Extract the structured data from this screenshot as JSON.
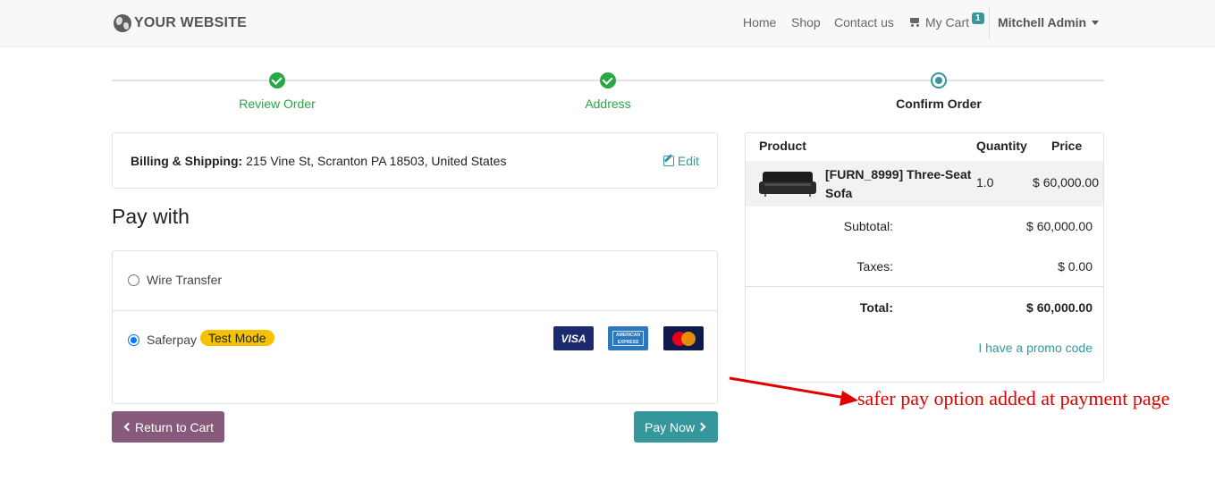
{
  "header": {
    "logo_text": "YOUR WEBSITE",
    "nav": {
      "home": "Home",
      "shop": "Shop",
      "contact": "Contact us",
      "cart": "My Cart",
      "cart_count": "1",
      "user": "Mitchell Admin"
    }
  },
  "wizard": {
    "steps": [
      {
        "label": "Review Order",
        "state": "done"
      },
      {
        "label": "Address",
        "state": "done"
      },
      {
        "label": "Confirm Order",
        "state": "current"
      }
    ]
  },
  "billing": {
    "label": "Billing & Shipping:",
    "address": "215 Vine St, Scranton PA 18503, United States",
    "edit_label": "Edit"
  },
  "payment": {
    "title": "Pay with",
    "options": [
      {
        "label": "Wire Transfer",
        "selected": false
      },
      {
        "label": "Saferpay",
        "selected": true,
        "badge": "Test Mode"
      }
    ],
    "card_icons": [
      "visa-icon",
      "amex-icon",
      "mastercard-icon"
    ],
    "visa_text": "VISA",
    "amex_text": "AMERICAN EXPRESS"
  },
  "buttons": {
    "return": "Return to Cart",
    "pay": "Pay Now"
  },
  "summary": {
    "headers": {
      "product": "Product",
      "quantity": "Quantity",
      "price": "Price"
    },
    "item": {
      "name": "[FURN_8999] Three-Seat Sofa",
      "quantity": "1.0",
      "price": "$ 60,000.00"
    },
    "subtotal_label": "Subtotal:",
    "subtotal": "$ 60,000.00",
    "taxes_label": "Taxes:",
    "taxes": "$ 0.00",
    "total_label": "Total:",
    "total": "$ 60,000.00",
    "promo": "I have a promo code"
  },
  "annotation": {
    "text": "safer pay option added at payment page",
    "color": "#e00000"
  },
  "colors": {
    "primary": "#35979c",
    "secondary": "#875a7b",
    "success": "#28a745",
    "badge": "#f6c100"
  }
}
